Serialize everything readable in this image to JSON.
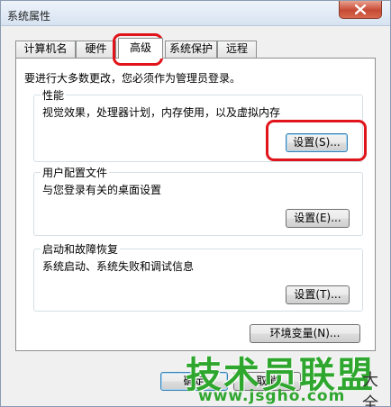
{
  "window": {
    "title": "系统属性"
  },
  "tabs": [
    {
      "label": "计算机名"
    },
    {
      "label": "硬件"
    },
    {
      "label": "高级"
    },
    {
      "label": "系统保护"
    },
    {
      "label": "远程"
    }
  ],
  "intro": "要进行大多数更改，您必须作为管理员登录。",
  "performance": {
    "label": "性能",
    "desc": "视觉效果，处理器计划，内存使用，以及虚拟内存",
    "button": "设置(S)..."
  },
  "profiles": {
    "label": "用户配置文件",
    "desc": "与您登录有关的桌面设置",
    "button": "设置(E)..."
  },
  "startup": {
    "label": "启动和故障恢复",
    "desc": "系统启动、系统失败和调试信息",
    "button": "设置(T)..."
  },
  "env_button": "环境变量(N)...",
  "footer": {
    "ok": "确定",
    "cancel": "取消"
  },
  "watermark": {
    "main": "技术员联盟",
    "side": "大全",
    "url": "www.jsgho.com"
  },
  "colors": {
    "highlight_ring": "#e0141a",
    "watermark": "#2fa72f"
  }
}
